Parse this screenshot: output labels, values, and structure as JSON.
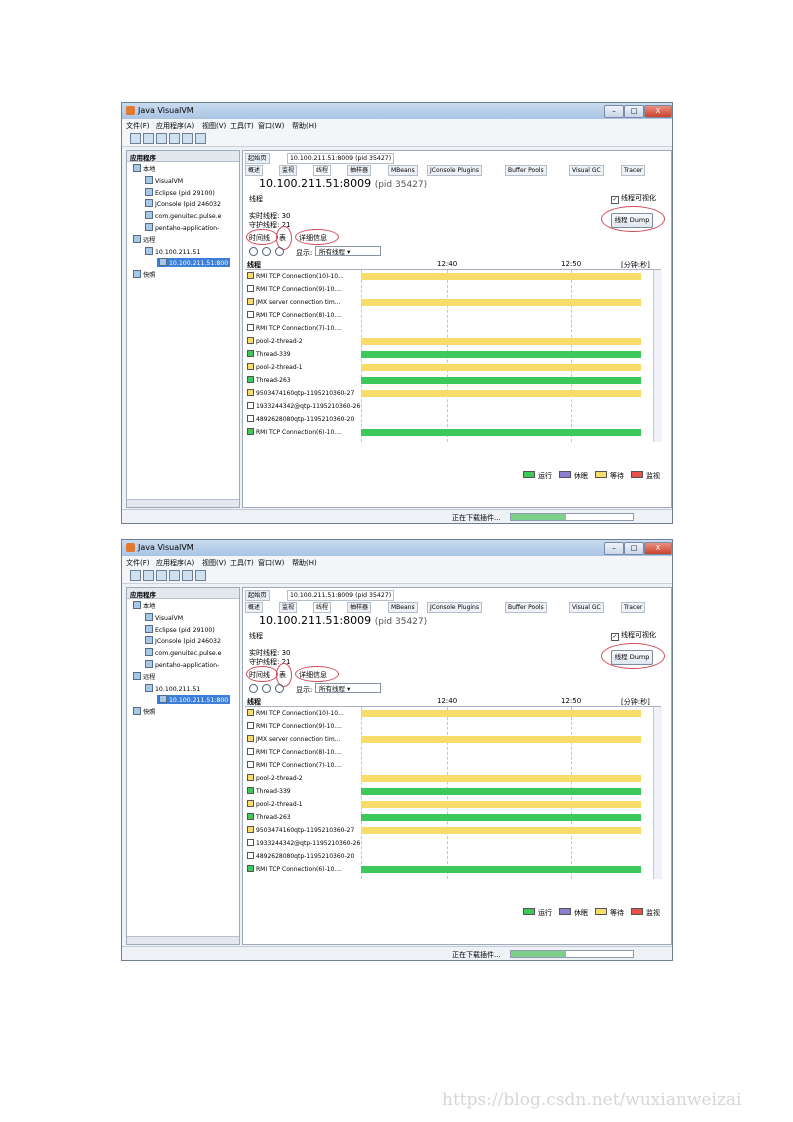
{
  "app": {
    "title": "Java VisualVM",
    "window_buttons": [
      "–",
      "□",
      "X"
    ],
    "menus": [
      "文件(F)",
      "应用程序(A)",
      "视图(V)",
      "工具(T)",
      "窗口(W)",
      "帮助(H)"
    ],
    "toolbar_icons": [
      "open-snapshot-icon",
      "save-icon",
      "jmx-connection-icon",
      "add-remote-icon",
      "add-core-dump-icon",
      "heap-dump-icon"
    ]
  },
  "left_panel": {
    "title": "应用程序",
    "tree": [
      {
        "label": "本地",
        "level": 0,
        "icon": "computer-icon"
      },
      {
        "label": "VisualVM",
        "level": 1,
        "icon": "java-app-icon"
      },
      {
        "label": "Eclipse (pid 29100)",
        "level": 1,
        "icon": "eclipse-icon"
      },
      {
        "label": "JConsole (pid 246032",
        "level": 1,
        "icon": "java-app-icon"
      },
      {
        "label": "com.genuitec.pulse.e",
        "level": 1,
        "icon": "java-app-icon"
      },
      {
        "label": "pentaho-application-",
        "level": 1,
        "icon": "java-app-icon"
      },
      {
        "label": "远程",
        "level": 0,
        "icon": "remote-icon"
      },
      {
        "label": "10.100.211.51",
        "level": 1,
        "icon": "host-icon"
      },
      {
        "label": "10.100.211.51:800",
        "level": 2,
        "icon": "java-app-icon",
        "selected": true
      },
      {
        "label": "快照",
        "level": 0,
        "icon": "snapshot-icon"
      }
    ]
  },
  "doc_tabs": [
    {
      "label": "起始页",
      "active": false
    },
    {
      "label": "10.100.211.51:8009 (pid 35427)",
      "active": true
    }
  ],
  "sub_tabs": [
    "概述",
    "监视",
    "线程",
    "抽样器",
    "MBeans",
    "JConsole Plugins",
    "Buffer Pools",
    "Visual GC",
    "Tracer"
  ],
  "active_sub_tab": "线程",
  "process": {
    "name": "10.100.211.51:8009",
    "pid": "(pid 35427)"
  },
  "threads_section": {
    "label": "线程",
    "visualize_label": "线程可视化",
    "live_label": "实时线程:",
    "live_value": "30",
    "daemon_label": "守护线程:",
    "daemon_value": "21",
    "dump_button": "线程 Dump"
  },
  "view_tabs": [
    "时间线",
    "表",
    "详细信息"
  ],
  "display": {
    "label": "显示:",
    "selected": "所有线程"
  },
  "timeline": {
    "column_label": "线程",
    "ticks": [
      "12:40",
      "12:50"
    ],
    "unit": "[分钟:秒]",
    "rows": [
      {
        "name": "RMI TCP Connection(10)-10...",
        "state": "wait"
      },
      {
        "name": "RMI TCP Connection(9)-10....",
        "state": "none"
      },
      {
        "name": "JMX server connection tim...",
        "state": "wait"
      },
      {
        "name": "RMI TCP Connection(8)-10....",
        "state": "none"
      },
      {
        "name": "RMI TCP Connection(7)-10....",
        "state": "none"
      },
      {
        "name": "pool-2-thread-2",
        "state": "wait"
      },
      {
        "name": "Thread-339",
        "state": "run"
      },
      {
        "name": "pool-2-thread-1",
        "state": "wait"
      },
      {
        "name": "Thread-263",
        "state": "run"
      },
      {
        "name": "9503474160qtp-1195210360-27",
        "state": "wait"
      },
      {
        "name": "1933244342@qtp-1195210360-26",
        "state": "none"
      },
      {
        "name": "4892628080qtp-1195210360-20",
        "state": "none"
      },
      {
        "name": "RMI TCP Connection(6)-10....",
        "state": "run"
      }
    ]
  },
  "legend": [
    {
      "label": "运行",
      "color": "#3cc85a"
    },
    {
      "label": "休眠",
      "color": "#8a7fd0"
    },
    {
      "label": "等待",
      "color": "#f7dc6a"
    },
    {
      "label": "监视",
      "color": "#e8504a"
    }
  ],
  "status": {
    "text": "正在下载插件...",
    "progress": 0.45
  },
  "watermark": "https://blog.csdn.net/wuxianweizai"
}
